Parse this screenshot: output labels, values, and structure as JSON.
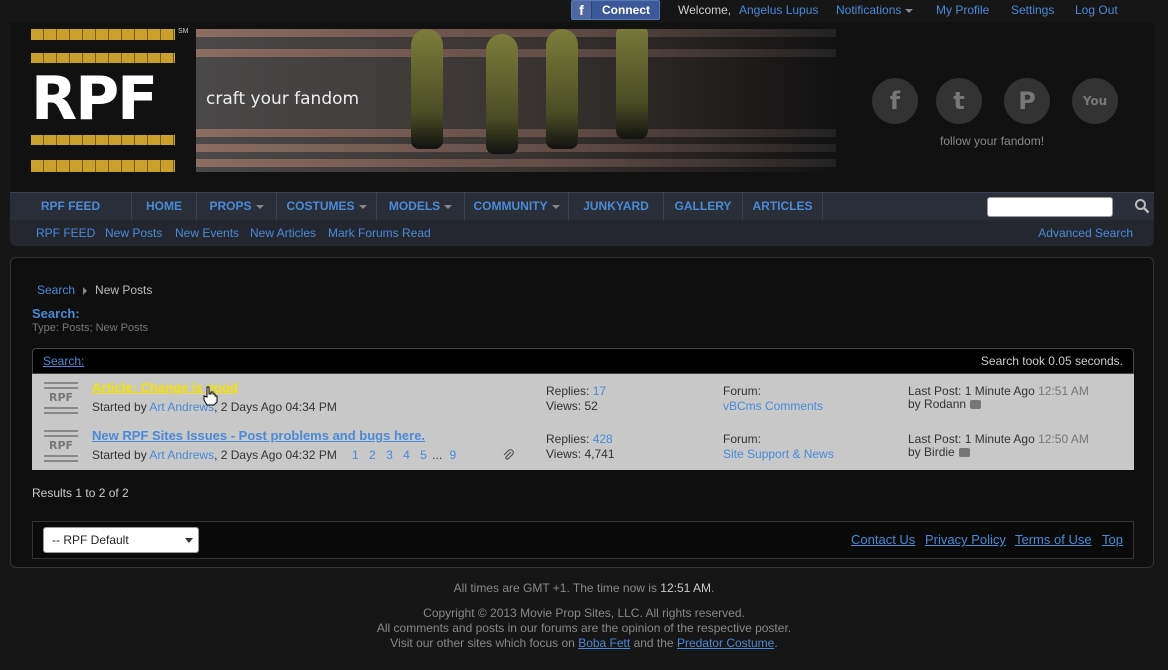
{
  "topbar": {
    "fb_connect": "Connect",
    "welcome": "Welcome,",
    "username": "Angelus Lupus",
    "notifications": "Notifications",
    "my_profile": "My Profile",
    "settings": "Settings",
    "logout": "Log Out"
  },
  "header": {
    "logo": "RPF",
    "trademark": "SM",
    "tagline": "craft your fandom",
    "follow": "follow your fandom!",
    "social": [
      "facebook-icon",
      "twitter-icon",
      "pinterest-icon",
      "youtube-icon"
    ]
  },
  "navbar": {
    "items": [
      "RPF FEED",
      "HOME",
      "PROPS",
      "COSTUMES",
      "MODELS",
      "COMMUNITY",
      "JUNKYARD",
      "GALLERY",
      "ARTICLES"
    ],
    "search_placeholder": ""
  },
  "subnav": {
    "items": [
      "RPF FEED",
      "New Posts",
      "New Events",
      "New Articles",
      "Mark Forums Read"
    ],
    "advanced_search": "Advanced Search"
  },
  "breadcrumb": {
    "root": "Search",
    "current": "New Posts"
  },
  "search": {
    "title": "Search:",
    "subtitle": "Type: Posts; New Posts",
    "results_label": "Search",
    "results_colon": ":",
    "took": "Search took 0.05 seconds."
  },
  "threads": [
    {
      "title": "Article: Change is good",
      "started_by": "Started by",
      "author": "Art Andrews",
      "date": ", 2 Days Ago 04:34 PM",
      "replies_label": "Replies:",
      "replies": "17",
      "views_label": "Views:",
      "views": "52",
      "forum_label": "Forum:",
      "forum": "vBCms Comments",
      "lastpost_label": "Last Post:",
      "lastpost_when": "1 Minute Ago",
      "lastpost_time": "12:51 AM",
      "by": "by",
      "lastpost_user": "Rodann",
      "pages": []
    },
    {
      "title": "New RPF Sites Issues - Post problems and bugs here.",
      "started_by": "Started by",
      "author": "Art Andrews",
      "date": ", 2 Days Ago 04:32 PM",
      "replies_label": "Replies:",
      "replies": "428",
      "views_label": "Views:",
      "views": "4,741",
      "forum_label": "Forum:",
      "forum": "Site Support & News",
      "lastpost_label": "Last Post:",
      "lastpost_when": "1 Minute Ago",
      "lastpost_time": "12:50 AM",
      "by": "by",
      "lastpost_user": "Birdie",
      "pages": [
        "1",
        "2",
        "3",
        "4",
        "5",
        "...",
        "9"
      ]
    }
  ],
  "results_count": "Results 1 to 2 of 2",
  "footer": {
    "style_select": "-- RPF Default",
    "links": [
      "Contact Us",
      "Privacy Policy",
      "Terms of Use",
      "Top"
    ]
  },
  "bottom": {
    "time_prefix": "All times are GMT +1. The time now is",
    "time_now": "12:51 AM",
    "time_suffix": ".",
    "copyright": "Copyright © 2013 Movie Prop Sites, LLC. All rights reserved.",
    "opinion": "All comments and posts in our forums are the opinion of the respective poster.",
    "visit_prefix": "Visit our other sites which focus on",
    "boba": "Boba Fett",
    "and_the": "and the",
    "predator": "Predator Costume",
    "period": "."
  },
  "colors": {
    "link": "#4a8ad6",
    "highlight_title": "#f5e400",
    "row_bg": "#c8c8c8"
  }
}
